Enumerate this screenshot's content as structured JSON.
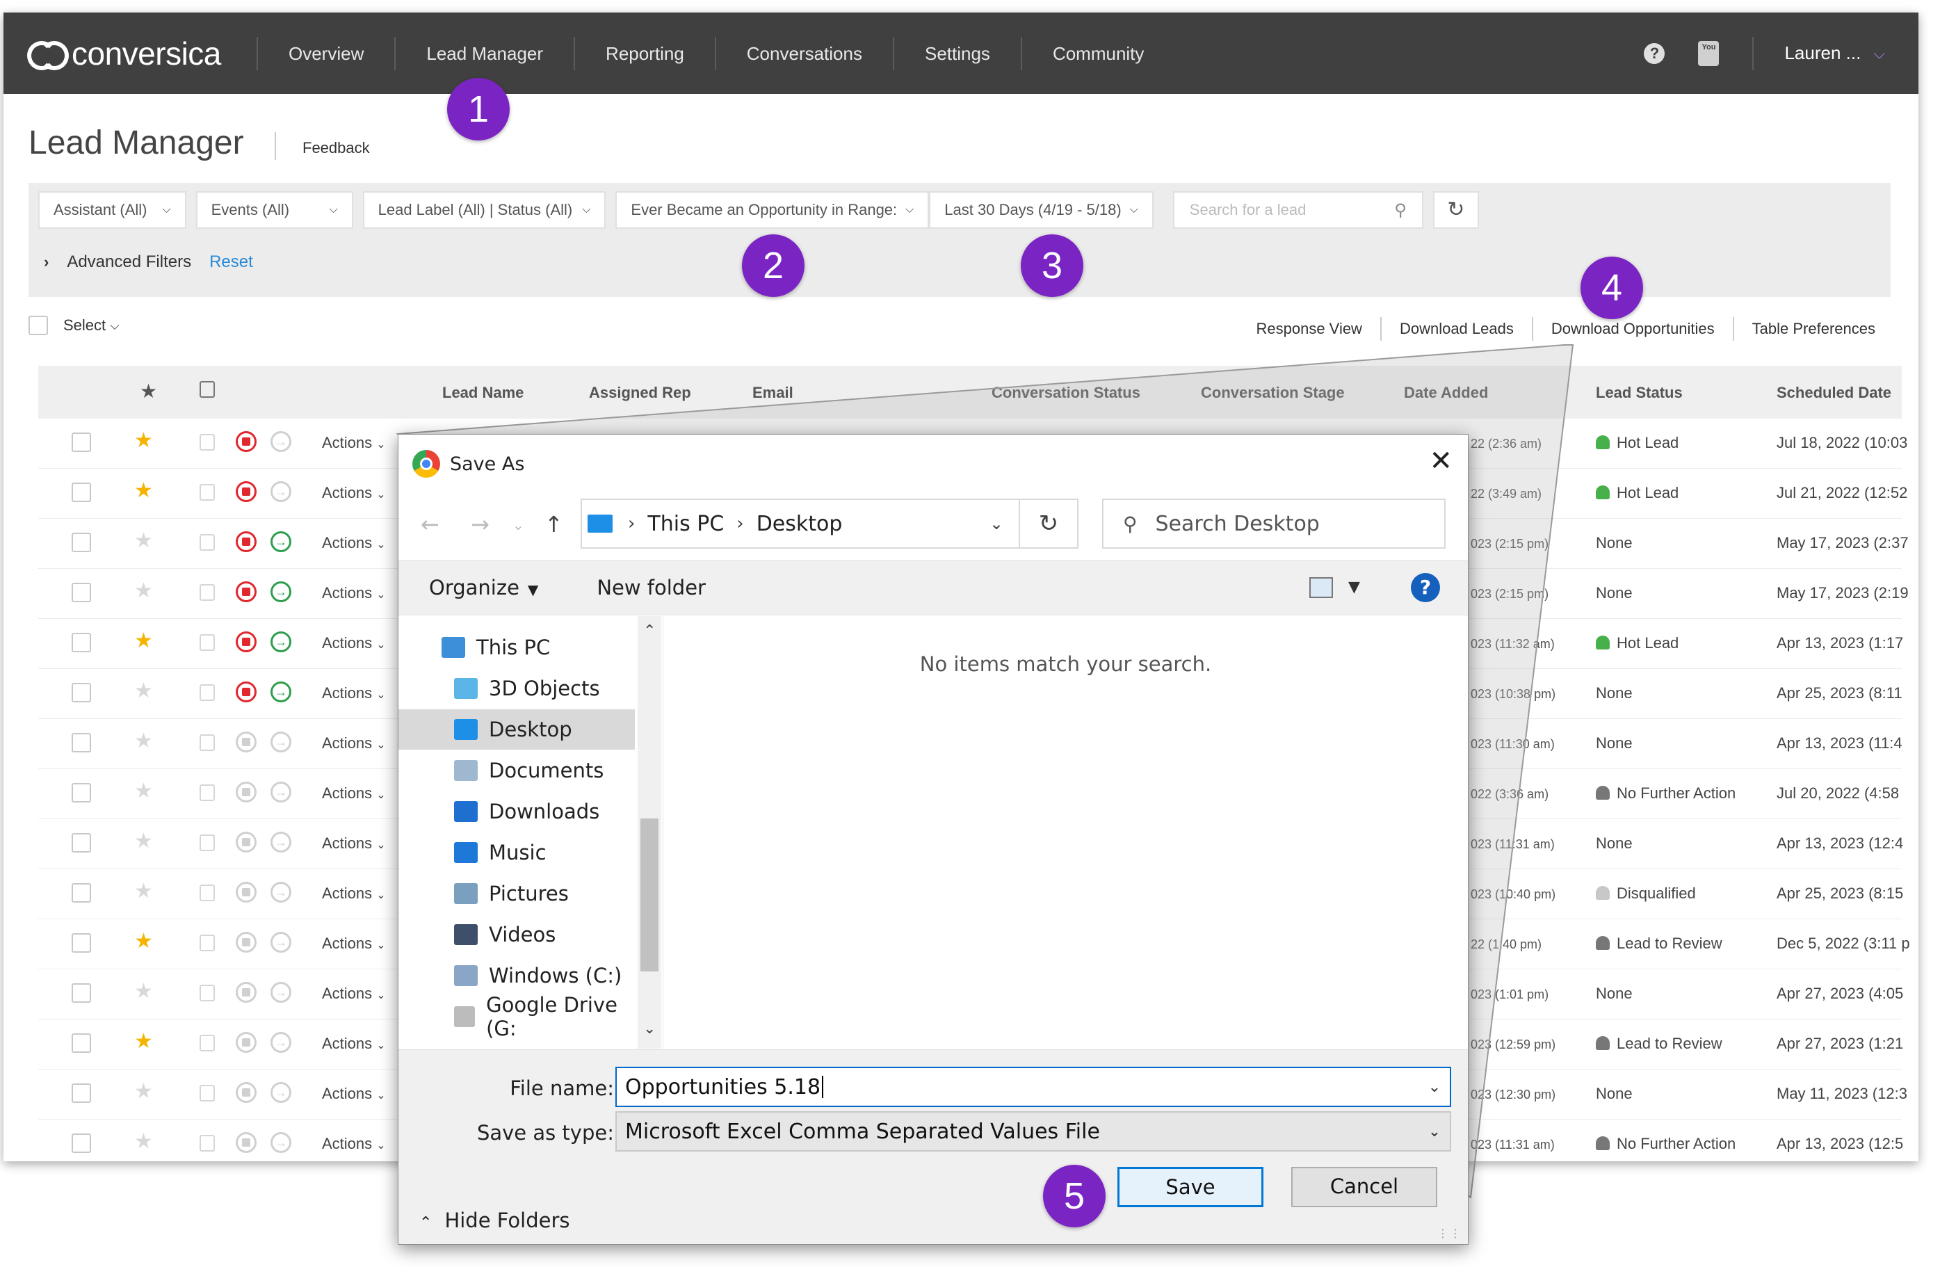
{
  "app": {
    "brand": "conversica",
    "nav": [
      "Overview",
      "Lead Manager",
      "Reporting",
      "Conversations",
      "Settings",
      "Community"
    ],
    "user": "Lauren ...",
    "help_glyph": "?",
    "youtube_glyph": "You"
  },
  "page": {
    "title": "Lead Manager",
    "feedback": "Feedback"
  },
  "filters": {
    "assistant": "Assistant (All)",
    "events": "Events (All)",
    "lead_label": "Lead Label (All) | Status (All)",
    "opportunity": "Ever Became an Opportunity in Range:",
    "range": "Last 30 Days (4/19 - 5/18)",
    "search_placeholder": "Search for a lead",
    "advanced": "Advanced Filters",
    "reset": "Reset"
  },
  "list_tools": {
    "select": "Select",
    "links": [
      "Response View",
      "Download Leads",
      "Download Opportunities",
      "Table Preferences"
    ]
  },
  "table": {
    "columns": [
      "Lead Name",
      "Assigned Rep",
      "Email",
      "Conversation Status",
      "Conversation Stage",
      "Date Added",
      "Lead Status",
      "Scheduled Date"
    ],
    "action_label": "Actions",
    "rows": [
      {
        "starred": true,
        "active": true,
        "stop_only": true,
        "date_added": "22 (2:36 am)",
        "status": "Hot Lead",
        "status_icon": "green",
        "scheduled": "Jul 18, 2022 (10:03"
      },
      {
        "starred": true,
        "active": true,
        "stop_only": true,
        "date_added": "22 (3:49 am)",
        "status": "Hot Lead",
        "status_icon": "green",
        "scheduled": "Jul 21, 2022 (12:52"
      },
      {
        "starred": false,
        "active": true,
        "stop_only": false,
        "date_added": "023 (2:15 pm)",
        "status": "None",
        "status_icon": "",
        "scheduled": "May 17, 2023 (2:37"
      },
      {
        "starred": false,
        "active": true,
        "stop_only": false,
        "date_added": "023 (2:15 pm)",
        "status": "None",
        "status_icon": "",
        "scheduled": "May 17, 2023 (2:19"
      },
      {
        "starred": true,
        "active": true,
        "stop_only": false,
        "date_added": "023 (11:32 am)",
        "status": "Hot Lead",
        "status_icon": "green",
        "scheduled": "Apr 13, 2023 (1:17"
      },
      {
        "starred": false,
        "active": true,
        "stop_only": false,
        "date_added": "023 (10:38 pm)",
        "status": "None",
        "status_icon": "",
        "scheduled": "Apr 25, 2023 (8:11"
      },
      {
        "starred": false,
        "active": false,
        "stop_only": false,
        "date_added": "023 (11:30 am)",
        "status": "None",
        "status_icon": "",
        "scheduled": "Apr 13, 2023 (11:4"
      },
      {
        "starred": false,
        "active": false,
        "stop_only": false,
        "date_added": "022 (3:36 am)",
        "status": "No Further Action",
        "status_icon": "gray",
        "scheduled": "Jul 20, 2022 (4:58"
      },
      {
        "starred": false,
        "active": false,
        "stop_only": false,
        "date_added": "023 (11:31 am)",
        "status": "None",
        "status_icon": "",
        "scheduled": "Apr 13, 2023 (12:4"
      },
      {
        "starred": false,
        "active": false,
        "stop_only": false,
        "date_added": "023 (10:40 pm)",
        "status": "Disqualified",
        "status_icon": "light",
        "scheduled": "Apr 25, 2023 (8:15"
      },
      {
        "starred": true,
        "active": false,
        "stop_only": false,
        "date_added": "22 (1:40 pm)",
        "status": "Lead to Review",
        "status_icon": "gray",
        "scheduled": "Dec 5, 2022 (3:11 p"
      },
      {
        "starred": false,
        "active": false,
        "stop_only": false,
        "date_added": "023 (1:01 pm)",
        "status": "None",
        "status_icon": "",
        "scheduled": "Apr 27, 2023 (4:05"
      },
      {
        "starred": true,
        "active": false,
        "stop_only": false,
        "date_added": "023 (12:59 pm)",
        "status": "Lead to Review",
        "status_icon": "gray",
        "scheduled": "Apr 27, 2023 (1:21"
      },
      {
        "starred": false,
        "active": false,
        "stop_only": false,
        "date_added": "023 (12:30 pm)",
        "status": "None",
        "status_icon": "",
        "scheduled": "May 11, 2023 (12:3"
      },
      {
        "starred": false,
        "active": false,
        "stop_only": false,
        "date_added": "023 (11:31 am)",
        "status": "No Further Action",
        "status_icon": "gray",
        "scheduled": "Apr 13, 2023 (12:5"
      }
    ]
  },
  "dialog": {
    "title": "Save As",
    "path": [
      "This PC",
      "Desktop"
    ],
    "search_placeholder": "Search Desktop",
    "organize": "Organize",
    "new_folder": "New folder",
    "tree": [
      {
        "label": "This PC",
        "icon": "pc-icon",
        "color": "#3c8fd8"
      },
      {
        "label": "3D Objects",
        "icon": "cube-icon",
        "color": "#5bb5e6"
      },
      {
        "label": "Desktop",
        "icon": "desktop-icon",
        "color": "#1e8fe6",
        "selected": true
      },
      {
        "label": "Documents",
        "icon": "document-icon",
        "color": "#9fb7cf"
      },
      {
        "label": "Downloads",
        "icon": "download-icon",
        "color": "#1e6fd0"
      },
      {
        "label": "Music",
        "icon": "music-icon",
        "color": "#1e78d8"
      },
      {
        "label": "Pictures",
        "icon": "picture-icon",
        "color": "#7a9fbf"
      },
      {
        "label": "Videos",
        "icon": "video-icon",
        "color": "#3d4f6a"
      },
      {
        "label": "Windows (C:)",
        "icon": "drive-icon",
        "color": "#8aa6c6"
      },
      {
        "label": "Google Drive (G:",
        "icon": "drive-icon",
        "color": "#bcbcbc"
      }
    ],
    "empty_message": "No items match your search.",
    "file_name_label": "File name:",
    "file_name_value": "Opportunities 5.18",
    "save_type_label": "Save as type:",
    "save_type_value": "Microsoft Excel Comma Separated Values File",
    "hide_folders": "Hide Folders",
    "save": "Save",
    "cancel": "Cancel"
  },
  "steps": [
    "1",
    "2",
    "3",
    "4",
    "5"
  ],
  "colors": {
    "nav_bg": "#404040",
    "badge": "#7b24c4",
    "star_on": "#f5b400",
    "star_off": "#d8d8d8",
    "stop_active": "#e0282e",
    "go_active": "#2e9e4e",
    "inactive": "#d0d0d0",
    "hot_lead": "#48b04a",
    "link": "#2a8ad6",
    "save_border": "#0078d7"
  }
}
